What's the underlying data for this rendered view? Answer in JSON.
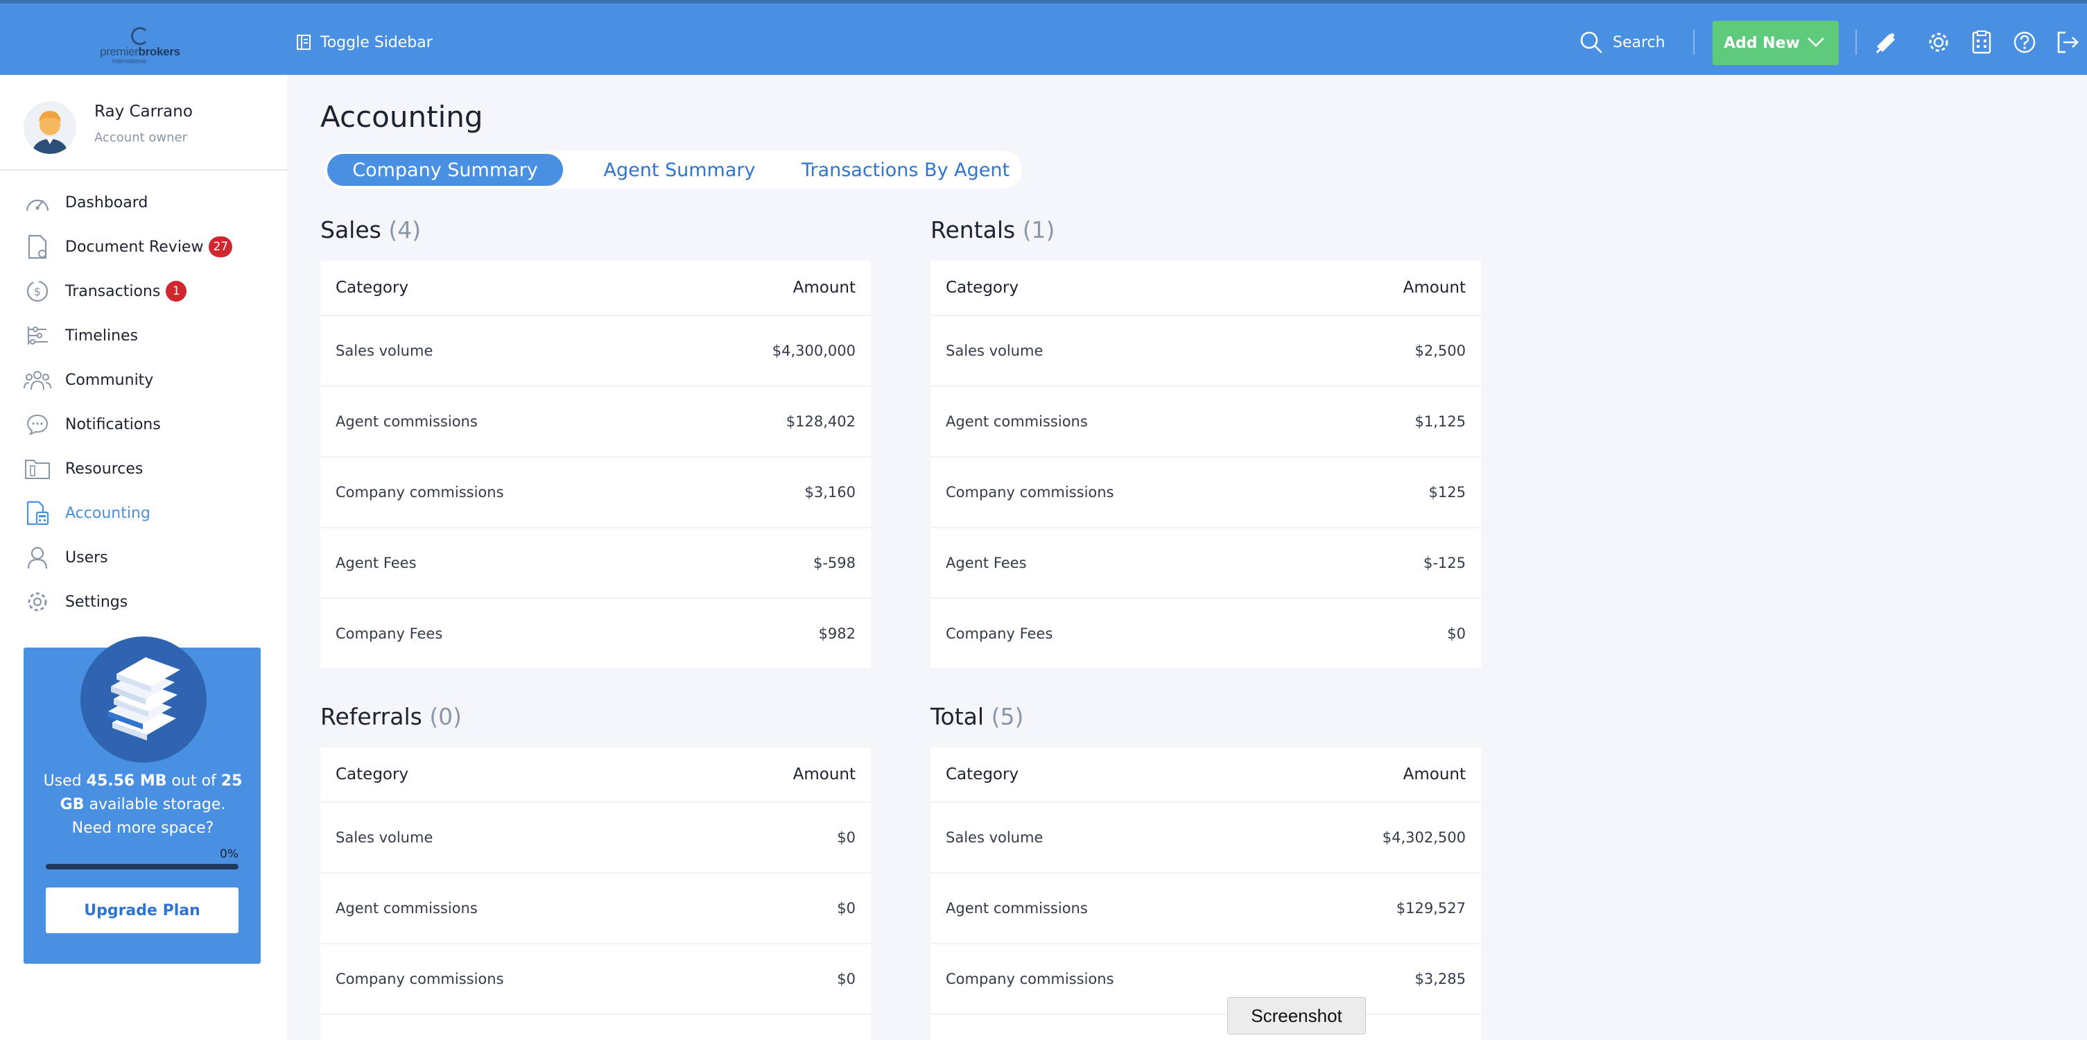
{
  "topbar": {
    "logo": {
      "word1": "premier",
      "word2": "brokers",
      "sub": "international"
    },
    "toggle_sidebar": "Toggle Sidebar",
    "search": "Search",
    "add_new": "Add New",
    "icons": [
      "bell-icon",
      "gear-icon",
      "calculator-icon",
      "help-icon",
      "logout-icon"
    ]
  },
  "user": {
    "name": "Ray Carrano",
    "role": "Account owner"
  },
  "nav": [
    {
      "label": "Dashboard",
      "icon": "speedometer-icon"
    },
    {
      "label": "Document Review",
      "icon": "document-icon",
      "badge": "27"
    },
    {
      "label": "Transactions",
      "icon": "dollar-icon",
      "badge": "1"
    },
    {
      "label": "Timelines",
      "icon": "timeline-icon"
    },
    {
      "label": "Community",
      "icon": "people-icon"
    },
    {
      "label": "Notifications",
      "icon": "chat-icon"
    },
    {
      "label": "Resources",
      "icon": "folder-icon"
    },
    {
      "label": "Accounting",
      "icon": "accounting-icon",
      "active": true
    },
    {
      "label": "Users",
      "icon": "user-icon"
    },
    {
      "label": "Settings",
      "icon": "gear-icon"
    }
  ],
  "storage": {
    "text_pre": "Used ",
    "used": "45.56 MB",
    "text_mid": " out of ",
    "total": "25 GB",
    "text_post": " available storage. Need more space?",
    "percent_label": "0%",
    "percent": 0,
    "upgrade": "Upgrade Plan"
  },
  "page": {
    "title": "Accounting",
    "tabs": [
      "Company Summary",
      "Agent Summary",
      "Transactions By Agent"
    ],
    "active_tab": 0
  },
  "sections": [
    {
      "title": "Sales",
      "count": "(4)",
      "header": {
        "category": "Category",
        "amount": "Amount"
      },
      "rows": [
        {
          "category": "Sales volume",
          "amount": "$4,300,000"
        },
        {
          "category": "Agent commissions",
          "amount": "$128,402"
        },
        {
          "category": "Company commissions",
          "amount": "$3,160"
        },
        {
          "category": "Agent Fees",
          "amount": "$-598"
        },
        {
          "category": "Company Fees",
          "amount": "$982"
        }
      ]
    },
    {
      "title": "Rentals",
      "count": "(1)",
      "header": {
        "category": "Category",
        "amount": "Amount"
      },
      "rows": [
        {
          "category": "Sales volume",
          "amount": "$2,500"
        },
        {
          "category": "Agent commissions",
          "amount": "$1,125"
        },
        {
          "category": "Company commissions",
          "amount": "$125"
        },
        {
          "category": "Agent Fees",
          "amount": "$-125"
        },
        {
          "category": "Company Fees",
          "amount": "$0"
        }
      ]
    },
    {
      "title": "Referrals",
      "count": "(0)",
      "header": {
        "category": "Category",
        "amount": "Amount"
      },
      "rows": [
        {
          "category": "Sales volume",
          "amount": "$0"
        },
        {
          "category": "Agent commissions",
          "amount": "$0"
        },
        {
          "category": "Company commissions",
          "amount": "$0"
        }
      ]
    },
    {
      "title": "Total",
      "count": "(5)",
      "header": {
        "category": "Category",
        "amount": "Amount"
      },
      "rows": [
        {
          "category": "Sales volume",
          "amount": "$4,302,500"
        },
        {
          "category": "Agent commissions",
          "amount": "$129,527"
        },
        {
          "category": "Company commissions",
          "amount": "$3,285"
        }
      ]
    }
  ],
  "tooltip": "Screenshot",
  "colors": {
    "primary": "#4a90e2",
    "success": "#5ecb7c",
    "badge": "#d0262d"
  }
}
